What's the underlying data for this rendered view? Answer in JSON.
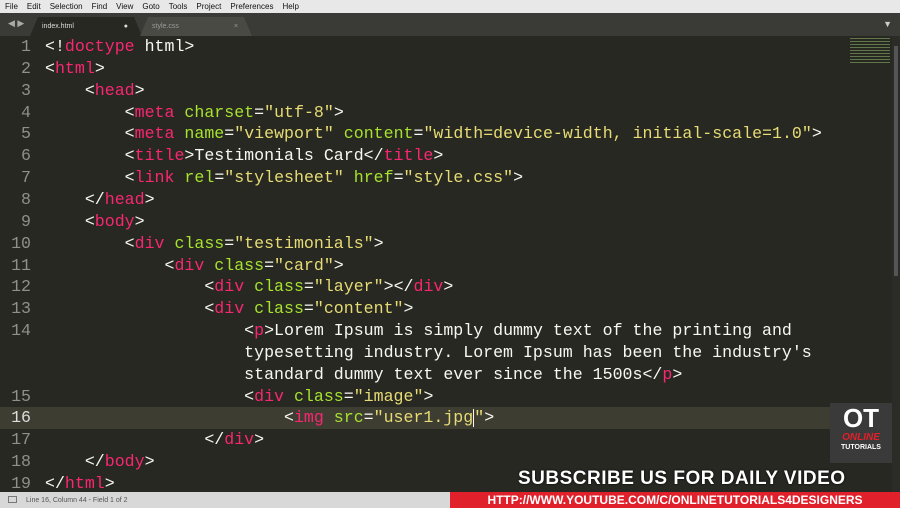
{
  "menu": [
    "File",
    "Edit",
    "Selection",
    "Find",
    "View",
    "Goto",
    "Tools",
    "Project",
    "Preferences",
    "Help"
  ],
  "tabs": [
    {
      "label": "index.html",
      "marker": "●"
    },
    {
      "label": "style.css",
      "marker": "×"
    }
  ],
  "rows": [
    {
      "n": "1",
      "t": [
        [
          "pun",
          "<!"
        ],
        [
          "tag",
          "doctype"
        ],
        [
          "pun",
          " html>"
        ]
      ]
    },
    {
      "n": "2",
      "t": [
        [
          "pun",
          "<"
        ],
        [
          "tag",
          "html"
        ],
        [
          "pun",
          ">"
        ]
      ]
    },
    {
      "n": "3",
      "t": [
        [
          "pun",
          "    <"
        ],
        [
          "tag",
          "head"
        ],
        [
          "pun",
          ">"
        ]
      ]
    },
    {
      "n": "4",
      "t": [
        [
          "pun",
          "        <"
        ],
        [
          "tag",
          "meta"
        ],
        [
          "attr",
          " charset"
        ],
        [
          "pun",
          "="
        ],
        [
          "str",
          "\"utf-8\""
        ],
        [
          "pun",
          ">"
        ]
      ]
    },
    {
      "n": "5",
      "t": [
        [
          "pun",
          "        <"
        ],
        [
          "tag",
          "meta"
        ],
        [
          "attr",
          " name"
        ],
        [
          "pun",
          "="
        ],
        [
          "str",
          "\"viewport\""
        ],
        [
          "attr",
          " content"
        ],
        [
          "pun",
          "="
        ],
        [
          "str",
          "\"width=device-width, initial-scale=1.0\""
        ],
        [
          "pun",
          ">"
        ]
      ]
    },
    {
      "n": "6",
      "t": [
        [
          "pun",
          "        <"
        ],
        [
          "tag",
          "title"
        ],
        [
          "pun",
          ">Testimonials Card</"
        ],
        [
          "tag",
          "title"
        ],
        [
          "pun",
          ">"
        ]
      ]
    },
    {
      "n": "7",
      "t": [
        [
          "pun",
          "        <"
        ],
        [
          "tag",
          "link"
        ],
        [
          "attr",
          " rel"
        ],
        [
          "pun",
          "="
        ],
        [
          "str",
          "\"stylesheet\""
        ],
        [
          "attr",
          " href"
        ],
        [
          "pun",
          "="
        ],
        [
          "str",
          "\"style.css\""
        ],
        [
          "pun",
          ">"
        ]
      ]
    },
    {
      "n": "8",
      "t": [
        [
          "pun",
          "    </"
        ],
        [
          "tag",
          "head"
        ],
        [
          "pun",
          ">"
        ]
      ]
    },
    {
      "n": "9",
      "t": [
        [
          "pun",
          "    <"
        ],
        [
          "tag",
          "body"
        ],
        [
          "pun",
          ">"
        ]
      ]
    },
    {
      "n": "10",
      "t": [
        [
          "pun",
          "        <"
        ],
        [
          "tag",
          "div"
        ],
        [
          "attr",
          " class"
        ],
        [
          "pun",
          "="
        ],
        [
          "str",
          "\"testimonials\""
        ],
        [
          "pun",
          ">"
        ]
      ]
    },
    {
      "n": "11",
      "t": [
        [
          "pun",
          "            <"
        ],
        [
          "tag",
          "div"
        ],
        [
          "attr",
          " class"
        ],
        [
          "pun",
          "="
        ],
        [
          "str",
          "\"card\""
        ],
        [
          "pun",
          ">"
        ]
      ]
    },
    {
      "n": "12",
      "t": [
        [
          "pun",
          "                <"
        ],
        [
          "tag",
          "div"
        ],
        [
          "attr",
          " class"
        ],
        [
          "pun",
          "="
        ],
        [
          "str",
          "\"layer\""
        ],
        [
          "pun",
          "></"
        ],
        [
          "tag",
          "div"
        ],
        [
          "pun",
          ">"
        ]
      ]
    },
    {
      "n": "13",
      "t": [
        [
          "pun",
          "                <"
        ],
        [
          "tag",
          "div"
        ],
        [
          "attr",
          " class"
        ],
        [
          "pun",
          "="
        ],
        [
          "str",
          "\"content\""
        ],
        [
          "pun",
          ">"
        ]
      ]
    },
    {
      "n": "14",
      "t": [
        [
          "pun",
          "                    <"
        ],
        [
          "tag",
          "p"
        ],
        [
          "pun",
          ">Lorem Ipsum is simply dummy text of the printing and"
        ]
      ]
    },
    {
      "n": "",
      "t": [
        [
          "pun",
          "                    typesetting industry. Lorem Ipsum has been the industry's"
        ]
      ]
    },
    {
      "n": "",
      "t": [
        [
          "pun",
          "                    standard dummy text ever since the 1500s</"
        ],
        [
          "tag",
          "p"
        ],
        [
          "pun",
          ">"
        ]
      ]
    },
    {
      "n": "15",
      "t": [
        [
          "pun",
          "                    <"
        ],
        [
          "tag",
          "div"
        ],
        [
          "attr",
          " class"
        ],
        [
          "pun",
          "="
        ],
        [
          "str",
          "\"image\""
        ],
        [
          "pun",
          ">"
        ]
      ]
    },
    {
      "n": "16",
      "cur": true,
      "t": [
        [
          "pun",
          "                        <"
        ],
        [
          "tag",
          "img"
        ],
        [
          "attr",
          " src"
        ],
        [
          "pun",
          "="
        ],
        [
          "str",
          "\"user1.jpg"
        ],
        [
          "caret",
          ""
        ],
        [
          "str",
          "\""
        ],
        [
          "pun",
          ">"
        ]
      ]
    },
    {
      "n": "17",
      "t": [
        [
          "pun",
          "                </"
        ],
        [
          "tag",
          "div"
        ],
        [
          "pun",
          ">"
        ]
      ]
    },
    {
      "n": "18",
      "t": [
        [
          "pun",
          "    </"
        ],
        [
          "tag",
          "body"
        ],
        [
          "pun",
          ">"
        ]
      ]
    },
    {
      "n": "19",
      "t": [
        [
          "pun",
          "</"
        ],
        [
          "tag",
          "html"
        ],
        [
          "pun",
          ">"
        ]
      ]
    }
  ],
  "status": "Line 16, Column 44 - Field 1 of 2",
  "logo": {
    "ot": "OT",
    "online": "ONLINE",
    "tutorials": "TUTORIALS"
  },
  "subscribe": "SUBSCRIBE US FOR DAILY VIDEO",
  "url": "HTTP://WWW.YOUTUBE.COM/C/ONLINETUTORIALS4DESIGNERS"
}
